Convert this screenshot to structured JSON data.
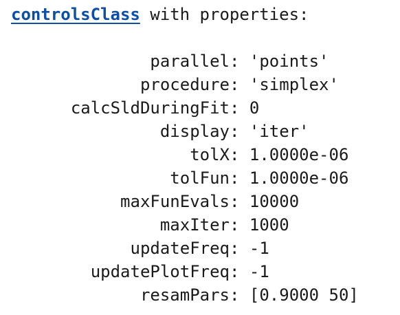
{
  "header": {
    "class_link": "controlsClass",
    "suffix": " with properties:"
  },
  "properties": [
    {
      "key": "parallel",
      "value": "'points'"
    },
    {
      "key": "procedure",
      "value": "'simplex'"
    },
    {
      "key": "calcSldDuringFit",
      "value": "0"
    },
    {
      "key": "display",
      "value": "'iter'"
    },
    {
      "key": "tolX",
      "value": "1.0000e-06"
    },
    {
      "key": "tolFun",
      "value": "1.0000e-06"
    },
    {
      "key": "maxFunEvals",
      "value": "10000"
    },
    {
      "key": "maxIter",
      "value": "1000"
    },
    {
      "key": "updateFreq",
      "value": "-1"
    },
    {
      "key": "updatePlotFreq",
      "value": "-1"
    },
    {
      "key": "resamPars",
      "value": "[0.9000 50]"
    }
  ],
  "colors": {
    "link": "#0e4fa6",
    "text": "#1a1a1a",
    "background": "#ffffff"
  }
}
